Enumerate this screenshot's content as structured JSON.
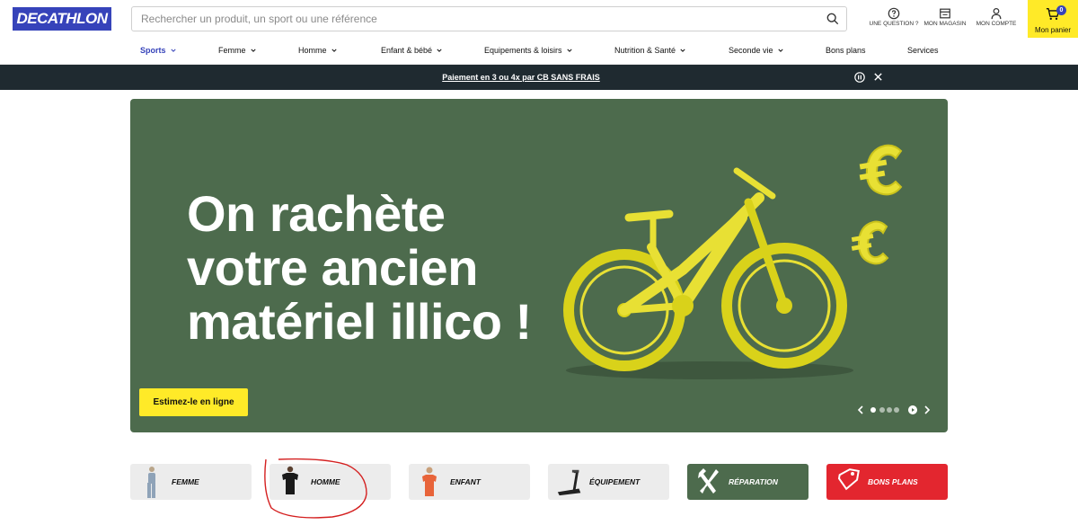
{
  "header": {
    "logo": "DECATHLON",
    "search_placeholder": "Rechercher un produit, un sport ou une référence",
    "actions": [
      {
        "label": "UNE QUESTION ?",
        "icon": "question-circle-icon"
      },
      {
        "label": "MON MAGASIN",
        "icon": "store-icon"
      },
      {
        "label": "MON COMPTE",
        "icon": "user-icon"
      }
    ],
    "cart": {
      "label": "Mon panier",
      "count": "0",
      "icon": "cart-icon"
    }
  },
  "nav": {
    "items": [
      {
        "label": "Sports",
        "chevron": true,
        "active": true
      },
      {
        "label": "Femme",
        "chevron": true
      },
      {
        "label": "Homme",
        "chevron": true
      },
      {
        "label": "Enfant & bébé",
        "chevron": true
      },
      {
        "label": "Equipements & loisirs",
        "chevron": true
      },
      {
        "label": "Nutrition & Santé",
        "chevron": true
      },
      {
        "label": "Seconde vie",
        "chevron": true
      },
      {
        "label": "Bons plans",
        "chevron": false
      },
      {
        "label": "Services",
        "chevron": false
      }
    ]
  },
  "promo": {
    "text": "Paiement en 3 ou 4x par CB SANS FRAIS"
  },
  "hero": {
    "title_line1": "On rachète",
    "title_line2": "votre ancien",
    "title_line3": "matériel illico !",
    "cta": "Estimez-le en ligne",
    "carousel": {
      "slides": 4,
      "active_index": 0
    }
  },
  "categories": [
    {
      "label": "FEMME",
      "style": "light"
    },
    {
      "label": "HOMME",
      "style": "light"
    },
    {
      "label": "ENFANT",
      "style": "light"
    },
    {
      "label": "ÉQUIPEMENT",
      "style": "light"
    },
    {
      "label": "RÉPARATION",
      "style": "green"
    },
    {
      "label": "BONS PLANS",
      "style": "red"
    }
  ],
  "colors": {
    "brand_blue": "#3643ba",
    "cta_yellow": "#ffea28",
    "hero_green": "#4d6b4d",
    "promo_dark": "#1f2a30",
    "red_tile": "#e3262f",
    "annotation_red": "#d42020"
  }
}
